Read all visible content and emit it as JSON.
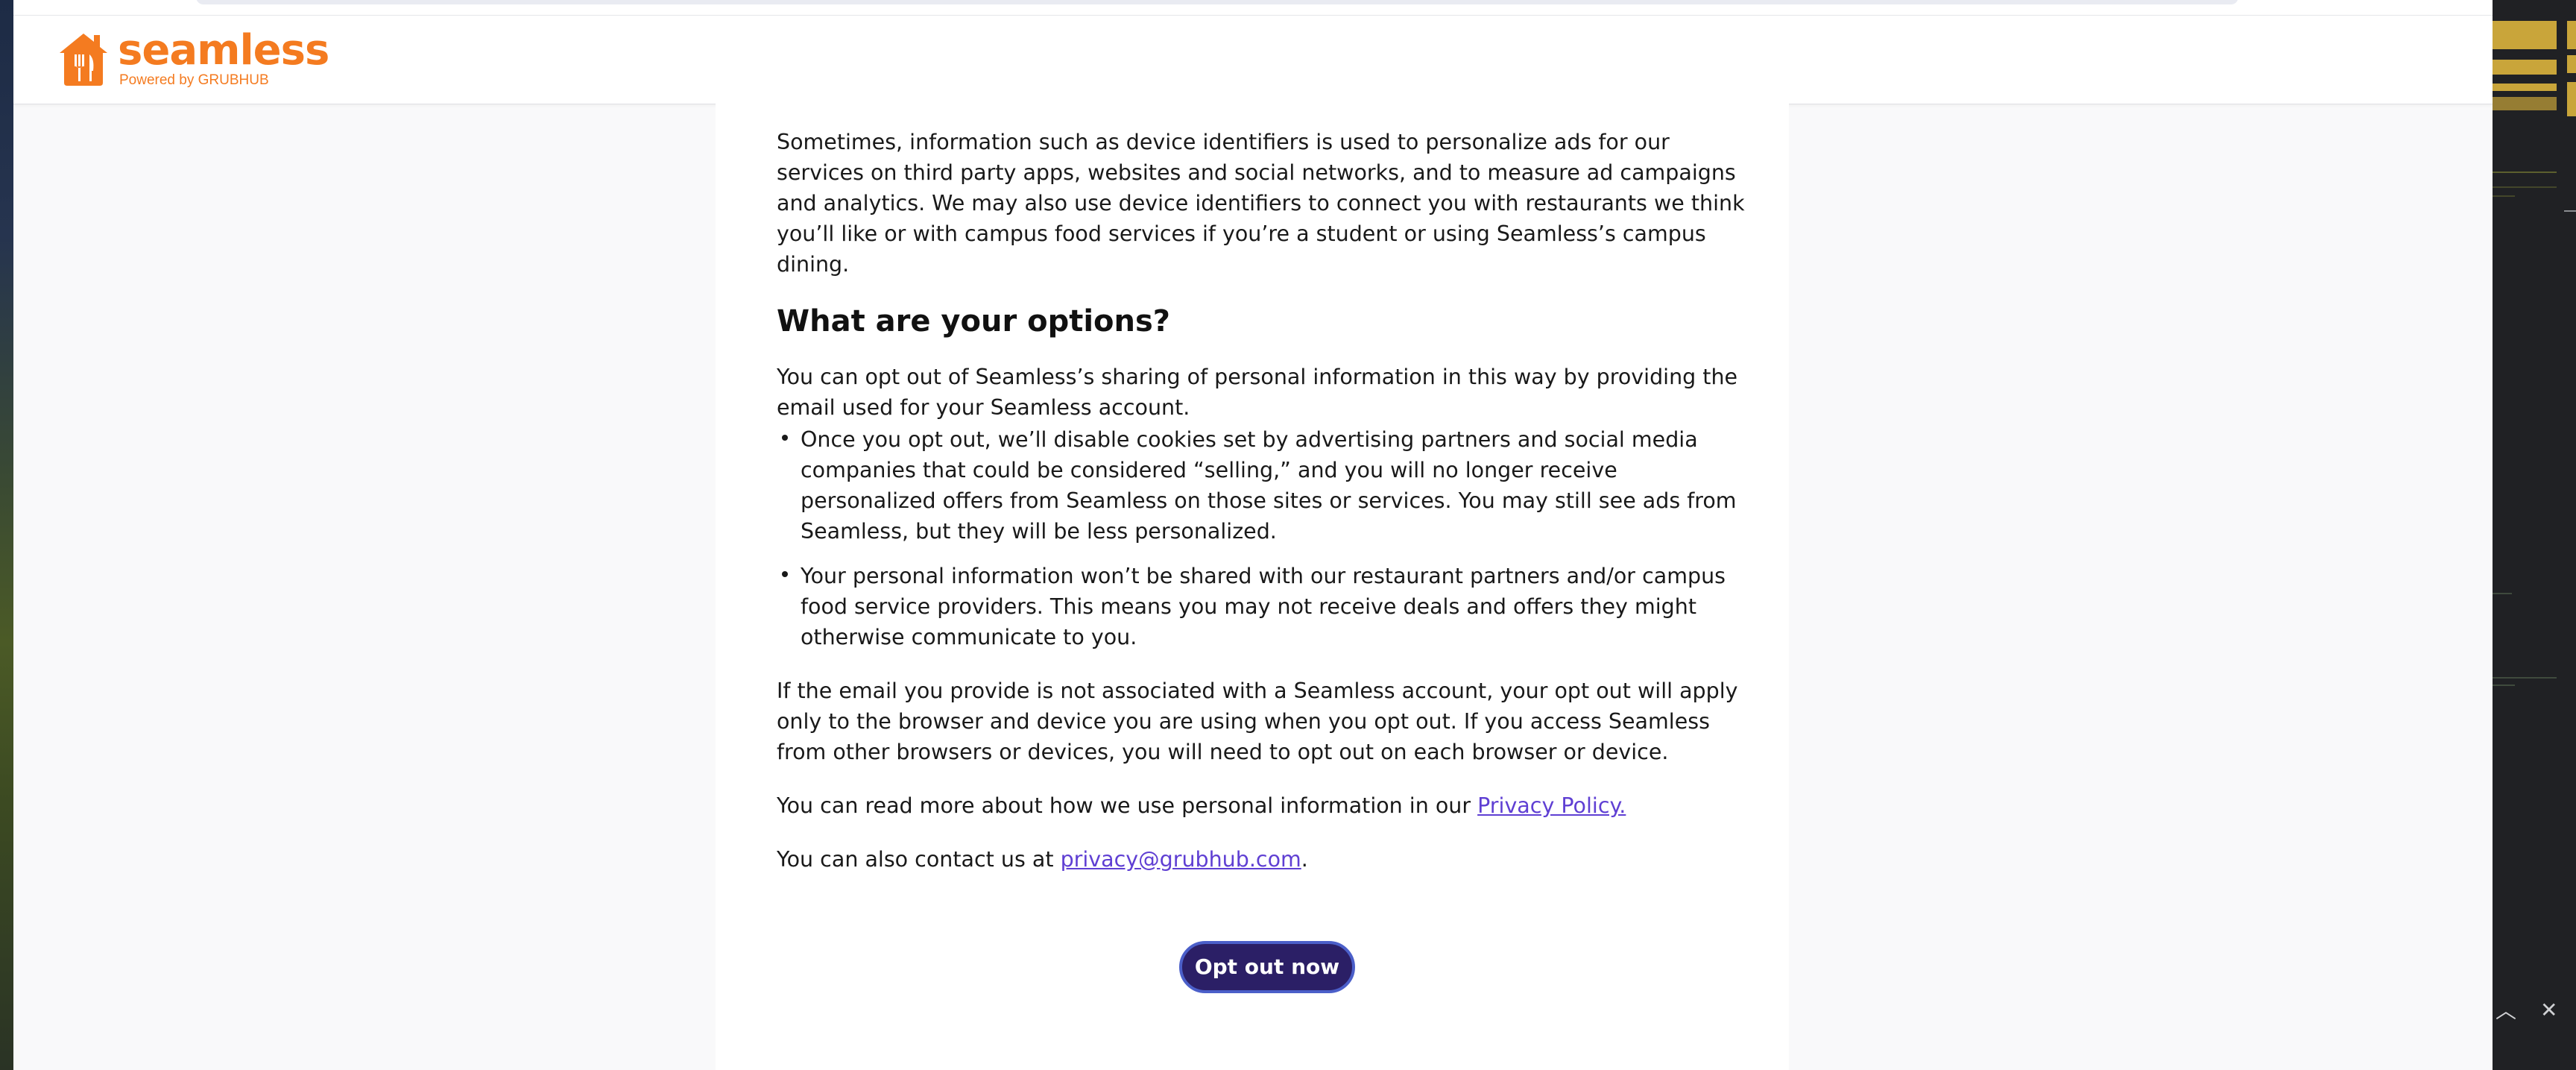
{
  "header": {
    "logo_word": "seamless",
    "logo_sub": "Powered by GRUBHUB",
    "brand_color": "#f47b20"
  },
  "content": {
    "para1": "Sometimes, information such as device identifiers is used to personalize ads for our services on third party apps, websites and social networks, and to measure ad campaigns and analytics. We may also use device identifiers to connect you with restaurants we think you’ll like or with campus food services if you’re a student or using Seamless’s campus dining.",
    "heading": "What are your options?",
    "para2": "You can opt out of Seamless’s sharing of personal information in this way by providing the email used for your Seamless account.",
    "bullets": [
      "Once you opt out, we’ll disable cookies set by advertising partners and social media companies that could be considered “selling,” and you will no longer receive personalized offers from Seamless on those sites or services. You may still see ads from Seamless, but they will be less personalized.",
      "Your personal information won’t be shared with our restaurant partners and/or campus food service providers. This means you may not receive deals and offers they might otherwise communicate to you."
    ],
    "para3": "If the email you provide is not associated with a Seamless account, your opt out will apply only to the browser and device you are using when you opt out. If you access Seamless from other browsers or devices, you will need to opt out on each browser or device.",
    "para4_prefix": "You can read more about how we use personal information in our ",
    "privacy_link": "Privacy Policy.",
    "para5_prefix": "You can also contact us at ",
    "email_link": "privacy@grubhub.com",
    "para5_suffix": ".",
    "link_color": "#5f3fd3"
  },
  "actions": {
    "opt_out_label": "Opt out now",
    "button_color": "#2b1f66"
  },
  "side_panel": {
    "up_icon": "chevron-up-icon",
    "close_icon": "close-icon",
    "up_glyph": "︿",
    "close_glyph": "✕"
  }
}
